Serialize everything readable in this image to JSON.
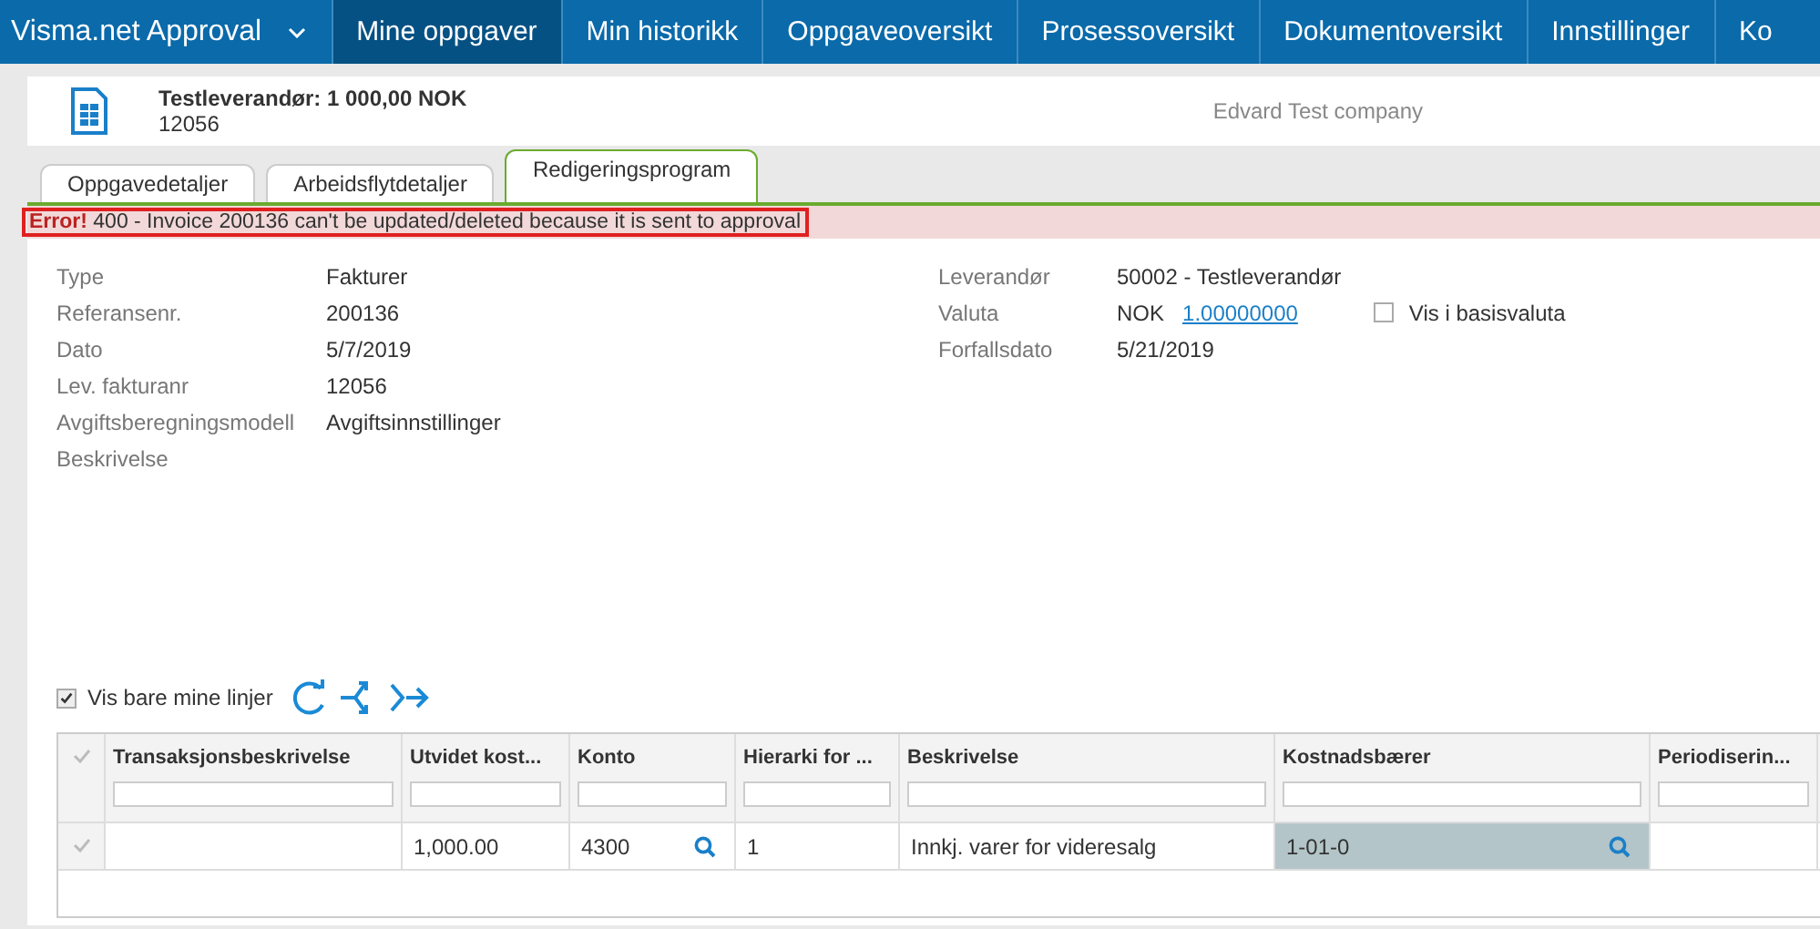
{
  "nav": {
    "app_title": "Visma.net Approval",
    "items": [
      {
        "label": "Mine oppgaver",
        "selected": true
      },
      {
        "label": "Min historikk",
        "selected": false
      },
      {
        "label": "Oppgaveoversikt",
        "selected": false
      },
      {
        "label": "Prosessoversikt",
        "selected": false
      },
      {
        "label": "Dokumentoversikt",
        "selected": false
      },
      {
        "label": "Innstillinger",
        "selected": false
      },
      {
        "label": "Ko",
        "selected": false
      }
    ]
  },
  "header": {
    "title": "Testleverandør: 1 000,00 NOK",
    "subtitle": "12056",
    "company": "Edvard Test company"
  },
  "tabs": [
    {
      "label": "Oppgavedetaljer",
      "selected": false
    },
    {
      "label": "Arbeidsflytdetaljer",
      "selected": false
    },
    {
      "label": "Redigeringsprogram",
      "selected": true
    }
  ],
  "error": {
    "text": "**Error!** 400 - Invoice 200136 can't be updated/deleted because it is sent to approval"
  },
  "fields_left": [
    {
      "label": "Type",
      "value": "Fakturer"
    },
    {
      "label": "Referansenr.",
      "value": "200136"
    },
    {
      "label": "Dato",
      "value": "5/7/2019"
    },
    {
      "label": "Lev. fakturanr",
      "value": "12056"
    },
    {
      "label": "Avgiftsberegningsmodell",
      "value": "Avgiftsinnstillinger"
    },
    {
      "label": "Beskrivelse"
    }
  ],
  "fields_right": [
    {
      "label": "Leverandør",
      "value": "50002 - Testleverandør"
    },
    {
      "label": "Valuta",
      "value": "NOK",
      "link": "1.00000000",
      "checkbox": {
        "label": "Vis i basisvaluta",
        "checked": false
      }
    },
    {
      "label": "Forfallsdato",
      "value": "5/21/2019"
    }
  ],
  "toolbar": {
    "checkbox": {
      "label": "Vis bare mine linjer",
      "checked": true
    }
  },
  "table": {
    "columns": [
      "Transaksjonsbeskrivelse",
      "Utvidet kost...",
      "Konto",
      "Hierarki for ...",
      "Beskrivelse",
      "Kostnadsbærer",
      "Periodiserin..."
    ],
    "rows": [
      {
        "cells": [
          "",
          "1,000.00",
          "4300",
          "1",
          "Innkj. varer for videresalg",
          "1-01-0",
          ""
        ],
        "lookup": [
          false,
          false,
          true,
          false,
          false,
          true,
          false
        ],
        "highlight": [
          false,
          false,
          false,
          false,
          false,
          true,
          false
        ]
      }
    ]
  }
}
